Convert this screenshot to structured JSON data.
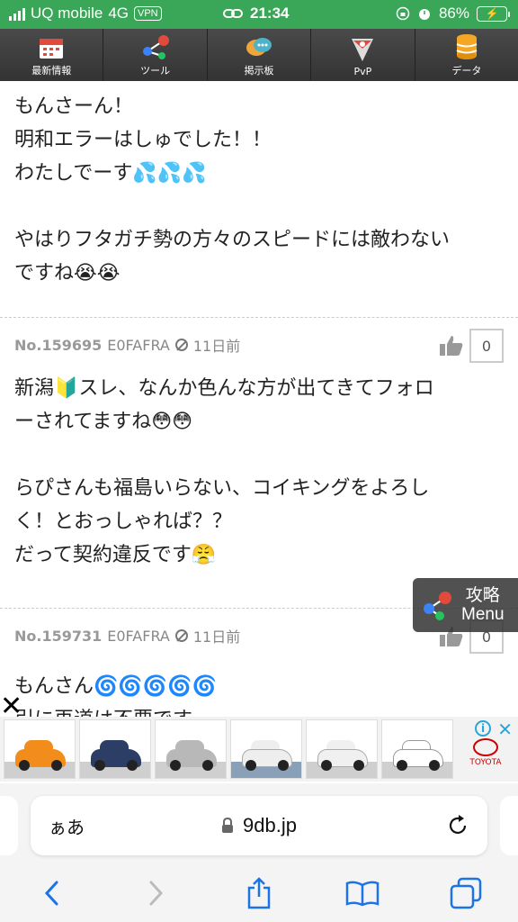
{
  "status_bar": {
    "carrier": "UQ mobile",
    "network": "4G",
    "vpn": "VPN",
    "time": "21:34",
    "battery": "86%"
  },
  "nav": [
    {
      "label": "最新情報",
      "icon": "calendar-icon"
    },
    {
      "label": "ツール",
      "icon": "share-icon"
    },
    {
      "label": "掲示板",
      "icon": "chat-icon"
    },
    {
      "label": "PvP",
      "icon": "pvp-icon"
    },
    {
      "label": "データ",
      "icon": "database-icon"
    }
  ],
  "posts": [
    {
      "lines": [
        "もんさーん！",
        "明和エラーはしゅでした！！",
        "わたしでーす💦💦💦",
        "",
        "やはりフタガチ勢の方々のスピードには敵わない",
        "ですね😭😭"
      ]
    },
    {
      "number": "No.159695",
      "user_id": "E0FAFRA",
      "time": "11日前",
      "likes": "0",
      "lines": [
        "新潟🔰スレ、なんか色んな方が出てきてフォロ",
        "ーされてますね😳😳",
        "",
        "らぴさんも福島いらない、コイキングをよろし",
        "く！とおっしゃれば？？",
        "だって契約違反です😤"
      ]
    },
    {
      "number": "No.159731",
      "user_id": "E0FAFRA",
      "time": "11日前",
      "likes": "0",
      "lines": [
        "もんさん🌀🌀🌀🌀🌀",
        "引に再道は不要です"
      ]
    }
  ],
  "floating_menu": {
    "line1": "攻略",
    "line2": "Menu"
  },
  "ad": {
    "close": "✕",
    "info": "i",
    "brand": "TOYOTA",
    "cars": [
      {
        "color": "#f28c1a"
      },
      {
        "color": "#2c3e66"
      },
      {
        "color": "#c0c0c0"
      },
      {
        "color": "#f5f5f5"
      },
      {
        "color": "#f5f5f5"
      },
      {
        "color": "#ffffff"
      }
    ]
  },
  "safari": {
    "aa": "ぁあ",
    "url": "9db.jp"
  },
  "colors": {
    "status_green": "#3aa657",
    "nav_dark": "#3c3c3c",
    "safari_blue": "#1a73e8"
  }
}
